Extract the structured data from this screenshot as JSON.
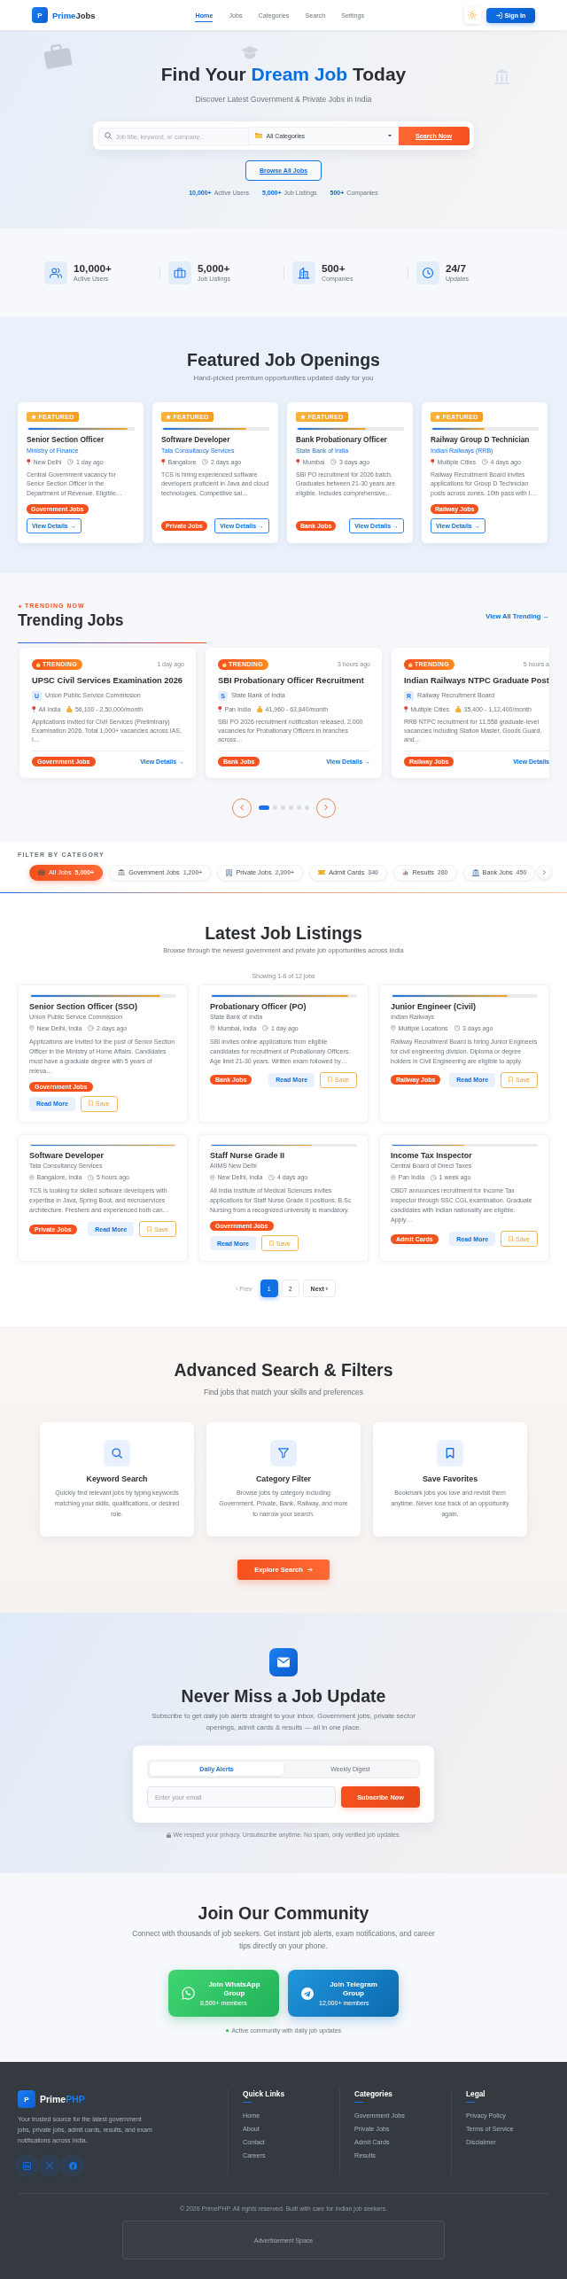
{
  "header": {
    "logo_letter": "P",
    "brand": [
      {
        "text": "Prime",
        "accent": true
      },
      {
        "text": "Jobs",
        "accent": false
      }
    ],
    "nav": [
      {
        "label": "Home",
        "selected": true
      },
      {
        "label": "Jobs",
        "selected": false
      },
      {
        "label": "Categories",
        "selected": false
      },
      {
        "label": "Search",
        "selected": false
      },
      {
        "label": "Settings",
        "selected": false
      }
    ],
    "sign_in": "Sign In"
  },
  "hero": {
    "title": [
      {
        "text": "Find Your ",
        "accent": false
      },
      {
        "text": "Dream Job",
        "accent": true
      },
      {
        "text": " Today",
        "accent": false
      }
    ],
    "subtitle": "Discover Latest Government & Private Jobs in India",
    "search": {
      "placeholder": "Job title, keyword, or company...",
      "category": "All Categories",
      "button": "Search Now"
    },
    "browse_button": "Browse All Jobs",
    "stats": [
      {
        "value": "10,000+",
        "label": "Active Users"
      },
      {
        "value": "5,000+",
        "label": "Job Listings"
      },
      {
        "value": "500+",
        "label": "Companies"
      }
    ]
  },
  "stats": [
    {
      "value": "10,000+",
      "label": "Active Users"
    },
    {
      "value": "5,000+",
      "label": "Job Listings"
    },
    {
      "value": "500+",
      "label": "Companies"
    },
    {
      "value": "24/7",
      "label": "Updates"
    }
  ],
  "featured": {
    "title": "Featured Job Openings",
    "subtitle": "Hand-picked premium opportunities updated daily for you",
    "cards": [
      {
        "badge": "★ FEATURED",
        "level": 0.95,
        "title": "Senior Section Officer",
        "company": "Ministry of Finance",
        "location": "New Delhi",
        "posted": "1 day ago",
        "description": "Central Government vacancy for Senior Section Officer in the Department of Revenue. Eligible…",
        "tag": "Government Jobs",
        "button": "View Details →"
      },
      {
        "badge": "★ FEATURED",
        "level": 0.8,
        "title": "Software Developer",
        "company": "Tata Consultancy Services",
        "location": "Bangalore",
        "posted": "2 days ago",
        "description": "TCS is hiring experienced software developers proficient in Java and cloud technologies. Competitive sal…",
        "tag": "Private Jobs",
        "button": "View Details →"
      },
      {
        "badge": "★ FEATURED",
        "level": 0.65,
        "title": "Bank Probationary Officer",
        "company": "State Bank of India",
        "location": "Mumbai",
        "posted": "3 days ago",
        "description": "SBI PO recruitment for 2026 batch. Graduates between 21-30 years are eligible. Includes comprehensive…",
        "tag": "Bank Jobs",
        "button": "View Details →"
      },
      {
        "badge": "★ FEATURED",
        "level": 0.5,
        "title": "Railway Group D Technician",
        "company": "Indian Railways (RRB)",
        "location": "Multiple Cities",
        "posted": "4 days ago",
        "description": "Railway Recruitment Board invites applications for Group D Technician posts across zones. 10th pass with I…",
        "tag": "Railway Jobs",
        "button": "View Details →"
      }
    ]
  },
  "trending": {
    "eyebrow": "TRENDING NOW",
    "title": "Trending Jobs",
    "view_all": "View All Trending →",
    "cards": [
      {
        "badge": "TRENDING",
        "posted": "1 day ago",
        "title": "UPSC Civil Services Examination 2026",
        "initial": "U",
        "organization": "Union Public Service Commission",
        "location": "All India",
        "salary": "56,100 - 2,50,000/month",
        "description": "Applications invited for Civil Services (Preliminary) Examination 2026. Total 1,000+ vacancies across IAS, I…",
        "tag": "Government Jobs",
        "link": "View Details →"
      },
      {
        "badge": "TRENDING",
        "posted": "3 hours ago",
        "title": "SBI Probationary Officer Recruitment",
        "initial": "S",
        "organization": "State Bank of India",
        "location": "Pan India",
        "salary": "41,960 - 63,840/month",
        "description": "SBI PO 2026 recruitment notification released. 2,000 vacancies for Probationary Officers in branches across…",
        "tag": "Bank Jobs",
        "link": "View Details →"
      },
      {
        "badge": "TRENDING",
        "posted": "5 hours a",
        "title": "Indian Railways NTPC Graduate Post",
        "initial": "R",
        "organization": "Railway Recruitment Board",
        "location": "Multiple Cities",
        "salary": "35,400 - 1,12,400/month",
        "description": "RRB NTPC recruitment for 11,558 graduate-level vacancies including Station Master, Goods Guard, and…",
        "tag": "Railway Jobs",
        "link": "View Details"
      }
    ],
    "dots": [
      {
        "selected": true
      },
      {
        "selected": false
      },
      {
        "selected": false
      },
      {
        "selected": false
      },
      {
        "selected": false
      },
      {
        "selected": false
      }
    ]
  },
  "filters": {
    "label": "FILTER BY CATEGORY",
    "pills": [
      {
        "label": "All Jobs",
        "count": "5,000+",
        "selected": true
      },
      {
        "label": "Government Jobs",
        "count": "1,200+",
        "selected": false
      },
      {
        "label": "Private Jobs",
        "count": "2,300+",
        "selected": false
      },
      {
        "label": "Admit Cards",
        "count": "340",
        "selected": false
      },
      {
        "label": "Results",
        "count": "280",
        "selected": false
      },
      {
        "label": "Bank Jobs",
        "count": "450",
        "selected": false
      }
    ]
  },
  "latest": {
    "title": "Latest Job Listings",
    "subtitle": "Browse through the newest government and private job opportunities across India",
    "showing": "Showing 1-6 of 12 jobs",
    "jobs": [
      {
        "level": 0.9,
        "title": "Senior Section Officer (SSO)",
        "company": "Union Public Service Commission",
        "location": "New Delhi, India",
        "posted": "2 days ago",
        "description": "Applications are invited for the post of Senior Section Officer in the Ministry of Home Affairs. Candidates must have a graduate degree with 5 years of releva…",
        "tag": "Government Jobs",
        "read_more": "Read More",
        "save": "Save"
      },
      {
        "level": 0.95,
        "title": "Probationary Officer (PO)",
        "company": "State Bank of India",
        "location": "Mumbai, India",
        "posted": "1 day ago",
        "description": "SBI invites online applications from eligible candidates for recruitment of Probationary Officers. Age limit 21-30 years. Written exam followed by…",
        "tag": "Bank Jobs",
        "read_more": "Read More",
        "save": "Save"
      },
      {
        "level": 0.8,
        "title": "Junior Engineer (Civil)",
        "company": "Indian Railways",
        "location": "Multiple Locations",
        "posted": "3 days ago",
        "description": "Railway Recruitment Board is hiring Junior Engineers for civil engineering division. Diploma or degree holders in Civil Engineering are eligible to apply.",
        "tag": "Railway Jobs",
        "read_more": "Read More",
        "save": "Save"
      },
      {
        "level": 1,
        "title": "Software Developer",
        "company": "Tata Consultancy Services",
        "location": "Bangalore, India",
        "posted": "5 hours ago",
        "description": "TCS is looking for skilled software developers with expertise in Java, Spring Boot, and microservices architecture. Freshers and experienced both can…",
        "tag": "Private Jobs",
        "read_more": "Read More",
        "save": "Save"
      },
      {
        "level": 0.7,
        "title": "Staff Nurse Grade II",
        "company": "AIIMS New Delhi",
        "location": "New Delhi, India",
        "posted": "4 days ago",
        "description": "All India Institute of Medical Sciences invites applications for Staff Nurse Grade II positions. B.Sc Nursing from a recognized university is mandatory.",
        "tag": "Government Jobs",
        "read_more": "Read More",
        "save": "Save"
      },
      {
        "level": 0.5,
        "title": "Income Tax Inspector",
        "company": "Central Board of Direct Taxes",
        "location": "Pan India",
        "posted": "1 week ago",
        "description": "CBDT announces recruitment for Income Tax Inspector through SSC CGL examination. Graduate candidates with Indian nationality are eligible. Apply…",
        "tag": "Admit Cards",
        "read_more": "Read More",
        "save": "Save"
      }
    ],
    "pagination": {
      "prev": {
        "label": "‹ Prev",
        "disabled": true
      },
      "pages": [
        {
          "label": "1",
          "selected": true
        },
        {
          "label": "2",
          "selected": false
        }
      ],
      "next": "Next ›"
    }
  },
  "advanced": {
    "title": "Advanced Search & Filters",
    "subtitle": "Find jobs that match your skills and preferences",
    "features": [
      {
        "title": "Keyword Search",
        "description": "Quickly find relevant jobs by typing keywords matching your skills, qualifications, or desired role."
      },
      {
        "title": "Category Filter",
        "description": "Browse jobs by category including Government, Private, Bank, Railway, and more to narrow your search."
      },
      {
        "title": "Save Favorites",
        "description": "Bookmark jobs you love and revisit them anytime. Never lose track of an opportunity again."
      }
    ],
    "button": "Explore Search"
  },
  "newsletter": {
    "title": "Never Miss a Job Update",
    "subtitle": "Subscribe to get daily job alerts straight to your inbox. Government jobs, private sector openings, admit cards & results — all in one place.",
    "tabs": [
      {
        "label": "Daily Alerts",
        "selected": true
      },
      {
        "label": "Weekly Digest",
        "selected": false
      }
    ],
    "email": {
      "placeholder": "Enter your email"
    },
    "button": "Subscribe Now",
    "privacy": "We respect your privacy. Unsubscribe anytime. No spam, only verified job updates."
  },
  "community": {
    "title": "Join Our Community",
    "subtitle": "Connect with thousands of job seekers. Get instant job alerts, exam notifications, and career tips directly on your phone.",
    "groups": [
      {
        "kind": "whatsapp",
        "label": "Join WhatsApp Group",
        "members": "8,500+ members"
      },
      {
        "kind": "telegram",
        "label": "Join Telegram Group",
        "members": "12,000+ members"
      }
    ],
    "note": "Active community with daily job updates"
  },
  "footer": {
    "logo_letter": "P",
    "brand": [
      {
        "text": "Prime",
        "accent": false
      },
      {
        "text": "PHP",
        "accent": true
      }
    ],
    "description": "Your trusted source for the latest government jobs, private jobs, admit cards, results, and exam notifications across India.",
    "columns": [
      {
        "heading": "Quick Links",
        "links": [
          "Home",
          "About",
          "Contact",
          "Careers"
        ]
      },
      {
        "heading": "Categories",
        "links": [
          "Government Jobs",
          "Private Jobs",
          "Admit Cards",
          "Results"
        ]
      },
      {
        "heading": "Legal",
        "links": [
          "Privacy Policy",
          "Terms of Service",
          "Disclaimer"
        ]
      }
    ],
    "copyright": "© 2026 PrimePHP. All rights reserved. Built with care for Indian job seekers.",
    "ad": "Advertisement Space"
  }
}
